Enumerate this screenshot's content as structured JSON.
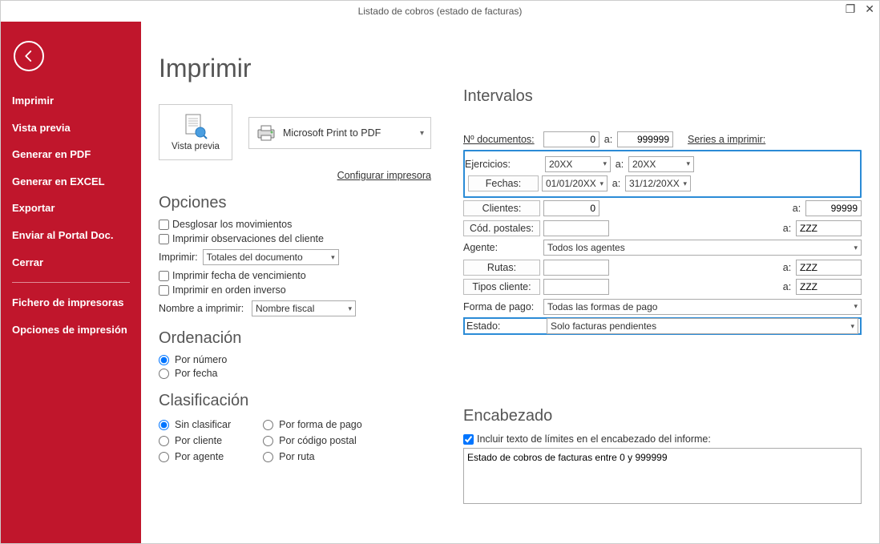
{
  "window": {
    "title": "Listado de cobros (estado de facturas)"
  },
  "sidebar": {
    "items": [
      "Imprimir",
      "Vista previa",
      "Generar en PDF",
      "Generar en EXCEL",
      "Exportar",
      "Enviar al Portal Doc.",
      "Cerrar"
    ],
    "footer": [
      "Fichero de impresoras",
      "Opciones de impresión"
    ]
  },
  "page": {
    "title": "Imprimir"
  },
  "preview_button": {
    "label": "Vista previa"
  },
  "printer": {
    "name": "Microsoft Print to PDF",
    "config_link": "Configurar impresora"
  },
  "opciones": {
    "title": "Opciones",
    "desglosar": "Desglosar los movimientos",
    "obs": "Imprimir observaciones del cliente",
    "imprimir_label": "Imprimir:",
    "imprimir_value": "Totales del documento",
    "fecha_venc": "Imprimir fecha de vencimiento",
    "orden_inv": "Imprimir en orden inverso",
    "nombre_label": "Nombre a imprimir:",
    "nombre_value": "Nombre fiscal"
  },
  "ordenacion": {
    "title": "Ordenación",
    "por_numero": "Por número",
    "por_fecha": "Por fecha"
  },
  "clasificacion": {
    "title": "Clasificación",
    "col1": [
      "Sin clasificar",
      "Por cliente",
      "Por agente"
    ],
    "col2": [
      "Por forma de pago",
      "Por código postal",
      "Por ruta"
    ]
  },
  "intervalos": {
    "title": "Intervalos",
    "ndoc_label": "Nº documentos:",
    "ndoc_from": "0",
    "a": "a:",
    "ndoc_to": "999999",
    "series_link": "Series a imprimir:",
    "ejercicios_label": "Ejercicios:",
    "ejercicios_from": "20XX",
    "ejercicios_to": "20XX",
    "fechas_label": "Fechas:",
    "fechas_from": "01/01/20XX",
    "fechas_to": "31/12/20XX",
    "clientes_label": "Clientes:",
    "clientes_from": "0",
    "clientes_to": "99999",
    "codpost_label": "Cód. postales:",
    "codpost_from": "",
    "codpost_to": "ZZZ",
    "agente_label": "Agente:",
    "agente_value": "Todos los agentes",
    "rutas_label": "Rutas:",
    "rutas_from": "",
    "rutas_to": "ZZZ",
    "tipos_label": "Tipos cliente:",
    "tipos_from": "",
    "tipos_to": "ZZZ",
    "formapago_label": "Forma de pago:",
    "formapago_value": "Todas las formas de pago",
    "estado_label": "Estado:",
    "estado_value": "Solo facturas pendientes"
  },
  "encabezado": {
    "title": "Encabezado",
    "check_label": "Incluir texto de límites en el encabezado del informe:",
    "text": "Estado de cobros de facturas entre 0 y 999999"
  }
}
